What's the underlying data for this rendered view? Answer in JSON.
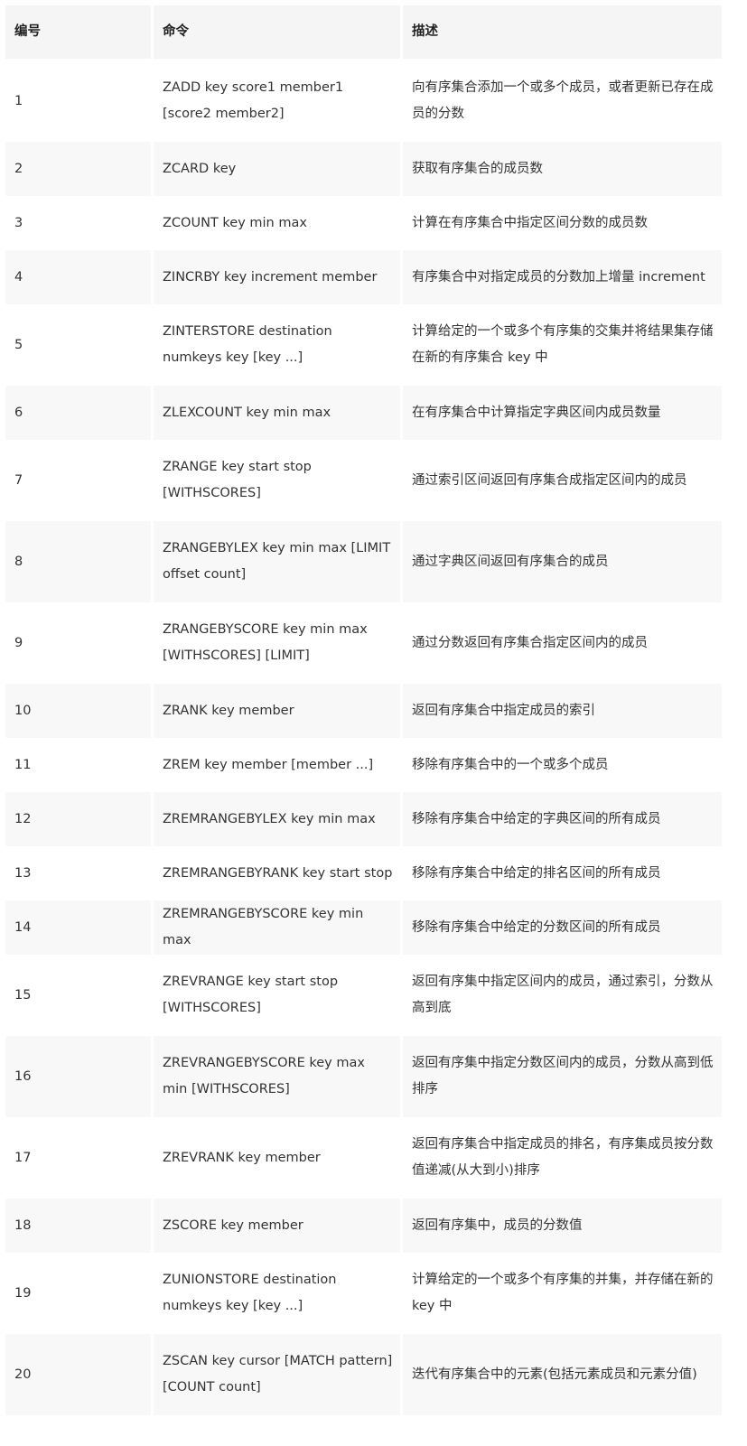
{
  "table": {
    "headers": {
      "num": "编号",
      "command": "命令",
      "description": "描述"
    },
    "rows": [
      {
        "num": "1",
        "command": "ZADD key score1 member1 [score2 member2]",
        "description": "向有序集合添加一个或多个成员，或者更新已存在成员的分数"
      },
      {
        "num": "2",
        "command": "ZCARD key",
        "description": "获取有序集合的成员数"
      },
      {
        "num": "3",
        "command": "ZCOUNT key min max",
        "description": "计算在有序集合中指定区间分数的成员数"
      },
      {
        "num": "4",
        "command": "ZINCRBY key increment member",
        "description": "有序集合中对指定成员的分数加上增量 increment"
      },
      {
        "num": "5",
        "command": "ZINTERSTORE destination numkeys key [key ...]",
        "description": "计算给定的一个或多个有序集的交集并将结果集存储在新的有序集合 key 中"
      },
      {
        "num": "6",
        "command": "ZLEXCOUNT key min max",
        "description": "在有序集合中计算指定字典区间内成员数量"
      },
      {
        "num": "7",
        "command": "ZRANGE key start stop [WITHSCORES]",
        "description": "通过索引区间返回有序集合成指定区间内的成员"
      },
      {
        "num": "8",
        "command": "ZRANGEBYLEX key min max [LIMIT offset count]",
        "description": "通过字典区间返回有序集合的成员"
      },
      {
        "num": "9",
        "command": "ZRANGEBYSCORE key min max [WITHSCORES] [LIMIT]",
        "description": "通过分数返回有序集合指定区间内的成员"
      },
      {
        "num": "10",
        "command": "ZRANK key member",
        "description": "返回有序集合中指定成员的索引"
      },
      {
        "num": "11",
        "command": "ZREM key member [member ...]",
        "description": "移除有序集合中的一个或多个成员"
      },
      {
        "num": "12",
        "command": "ZREMRANGEBYLEX key min max",
        "description": "移除有序集合中给定的字典区间的所有成员"
      },
      {
        "num": "13",
        "command": "ZREMRANGEBYRANK key start stop",
        "description": "移除有序集合中给定的排名区间的所有成员"
      },
      {
        "num": "14",
        "command": "ZREMRANGEBYSCORE key min max",
        "description": "移除有序集合中给定的分数区间的所有成员"
      },
      {
        "num": "15",
        "command": "ZREVRANGE key start stop [WITHSCORES]",
        "description": "返回有序集中指定区间内的成员，通过索引，分数从高到底"
      },
      {
        "num": "16",
        "command": "ZREVRANGEBYSCORE key max min [WITHSCORES]",
        "description": "返回有序集中指定分数区间内的成员，分数从高到低排序"
      },
      {
        "num": "17",
        "command": "ZREVRANK key member",
        "description": "返回有序集合中指定成员的排名，有序集成员按分数值递减(从大到小)排序"
      },
      {
        "num": "18",
        "command": "ZSCORE key member",
        "description": "返回有序集中，成员的分数值"
      },
      {
        "num": "19",
        "command": "ZUNIONSTORE destination numkeys key [key ...]",
        "description": "计算给定的一个或多个有序集的并集，并存储在新的 key 中"
      },
      {
        "num": "20",
        "command": "ZSCAN key cursor [MATCH pattern] [COUNT count]",
        "description": "迭代有序集合中的元素(包括元素成员和元素分值)"
      }
    ]
  }
}
